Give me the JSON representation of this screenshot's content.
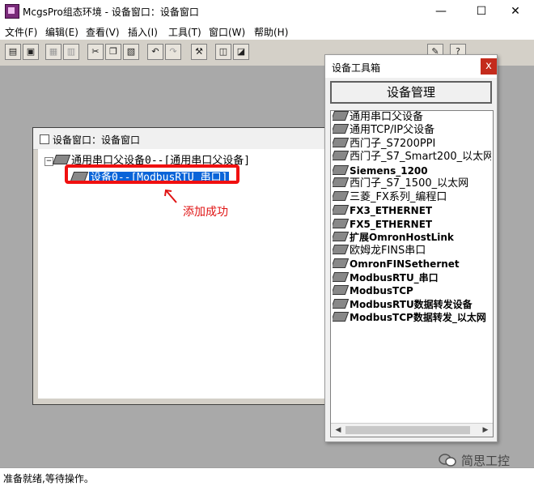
{
  "window": {
    "title": "McgsPro组态环境 - 设备窗口：设备窗口",
    "minimize_glyph": "—",
    "maximize_glyph": "☐",
    "close_glyph": "✕"
  },
  "menu": [
    "文件(F)",
    "编辑(E)",
    "查看(V)",
    "插入(I)",
    "工具(T)",
    "窗口(W)",
    "帮助(H)"
  ],
  "toolbar": {
    "icons": [
      "new-icon",
      "save-icon",
      "print-icon",
      "print-preview-icon",
      "cut-icon",
      "copy-icon",
      "paste-icon",
      "undo-icon",
      "redo-icon",
      "tools-icon",
      "device-icon",
      "device-config-icon",
      "help-icon",
      "help-context-icon"
    ]
  },
  "child_window": {
    "title": "设备窗口：设备窗口",
    "tree": {
      "expander": "−",
      "parent": "通用串口父设备0--[通用串口父设备]",
      "child": "设备0--[ModbusRTU_串口]"
    }
  },
  "annotation": {
    "text": "添加成功",
    "color": "#e01414"
  },
  "toolbox": {
    "title": "设备工具箱",
    "close_glyph": "x",
    "manage_button": "设备管理",
    "items": [
      "通用串口父设备",
      "通用TCP/IP父设备",
      "西门子_S7200PPI",
      "西门子_S7_Smart200_以太网",
      "Siemens_1200",
      "西门子_S7_1500_以太网",
      "三菱_FX系列_编程口",
      "FX3_ETHERNET",
      "FX5_ETHERNET",
      "扩展OmronHostLink",
      "欧姆龙FINS串口",
      "OmronFINSethernet",
      "ModbusRTU_串口",
      "ModbusTCP",
      "ModbusRTU数据转发设备",
      "ModbusTCP数据转发_以太网"
    ],
    "scroll_left": "◀",
    "scroll_right": "▶"
  },
  "status": {
    "text": "准备就绪,等待操作。"
  },
  "watermark": {
    "text": "简思工控"
  },
  "colors": {
    "selection": "#0a64d8",
    "highlight_box": "#f01010",
    "workspace": "#a9a9a9"
  }
}
